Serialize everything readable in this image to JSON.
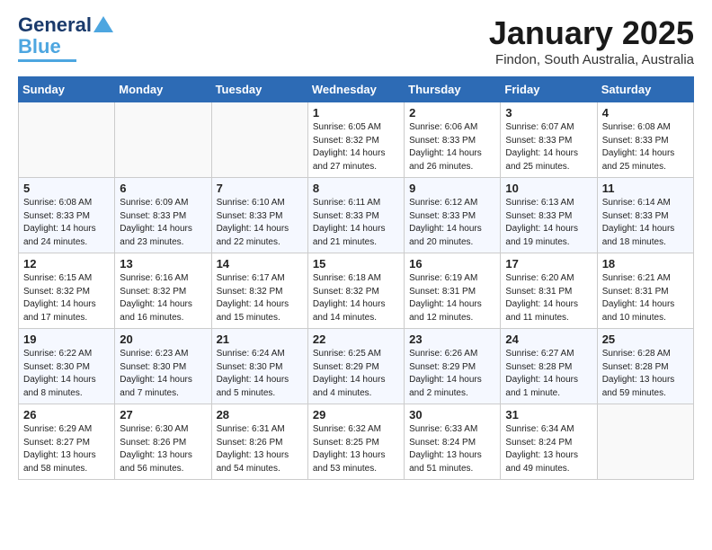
{
  "header": {
    "logo_line1": "General",
    "logo_line2": "Blue",
    "month_title": "January 2025",
    "subtitle": "Findon, South Australia, Australia"
  },
  "days_of_week": [
    "Sunday",
    "Monday",
    "Tuesday",
    "Wednesday",
    "Thursday",
    "Friday",
    "Saturday"
  ],
  "weeks": [
    [
      {
        "day": "",
        "sunrise": "",
        "sunset": "",
        "daylight": ""
      },
      {
        "day": "",
        "sunrise": "",
        "sunset": "",
        "daylight": ""
      },
      {
        "day": "",
        "sunrise": "",
        "sunset": "",
        "daylight": ""
      },
      {
        "day": "1",
        "sunrise": "Sunrise: 6:05 AM",
        "sunset": "Sunset: 8:32 PM",
        "daylight": "Daylight: 14 hours and 27 minutes."
      },
      {
        "day": "2",
        "sunrise": "Sunrise: 6:06 AM",
        "sunset": "Sunset: 8:33 PM",
        "daylight": "Daylight: 14 hours and 26 minutes."
      },
      {
        "day": "3",
        "sunrise": "Sunrise: 6:07 AM",
        "sunset": "Sunset: 8:33 PM",
        "daylight": "Daylight: 14 hours and 25 minutes."
      },
      {
        "day": "4",
        "sunrise": "Sunrise: 6:08 AM",
        "sunset": "Sunset: 8:33 PM",
        "daylight": "Daylight: 14 hours and 25 minutes."
      }
    ],
    [
      {
        "day": "5",
        "sunrise": "Sunrise: 6:08 AM",
        "sunset": "Sunset: 8:33 PM",
        "daylight": "Daylight: 14 hours and 24 minutes."
      },
      {
        "day": "6",
        "sunrise": "Sunrise: 6:09 AM",
        "sunset": "Sunset: 8:33 PM",
        "daylight": "Daylight: 14 hours and 23 minutes."
      },
      {
        "day": "7",
        "sunrise": "Sunrise: 6:10 AM",
        "sunset": "Sunset: 8:33 PM",
        "daylight": "Daylight: 14 hours and 22 minutes."
      },
      {
        "day": "8",
        "sunrise": "Sunrise: 6:11 AM",
        "sunset": "Sunset: 8:33 PM",
        "daylight": "Daylight: 14 hours and 21 minutes."
      },
      {
        "day": "9",
        "sunrise": "Sunrise: 6:12 AM",
        "sunset": "Sunset: 8:33 PM",
        "daylight": "Daylight: 14 hours and 20 minutes."
      },
      {
        "day": "10",
        "sunrise": "Sunrise: 6:13 AM",
        "sunset": "Sunset: 8:33 PM",
        "daylight": "Daylight: 14 hours and 19 minutes."
      },
      {
        "day": "11",
        "sunrise": "Sunrise: 6:14 AM",
        "sunset": "Sunset: 8:33 PM",
        "daylight": "Daylight: 14 hours and 18 minutes."
      }
    ],
    [
      {
        "day": "12",
        "sunrise": "Sunrise: 6:15 AM",
        "sunset": "Sunset: 8:32 PM",
        "daylight": "Daylight: 14 hours and 17 minutes."
      },
      {
        "day": "13",
        "sunrise": "Sunrise: 6:16 AM",
        "sunset": "Sunset: 8:32 PM",
        "daylight": "Daylight: 14 hours and 16 minutes."
      },
      {
        "day": "14",
        "sunrise": "Sunrise: 6:17 AM",
        "sunset": "Sunset: 8:32 PM",
        "daylight": "Daylight: 14 hours and 15 minutes."
      },
      {
        "day": "15",
        "sunrise": "Sunrise: 6:18 AM",
        "sunset": "Sunset: 8:32 PM",
        "daylight": "Daylight: 14 hours and 14 minutes."
      },
      {
        "day": "16",
        "sunrise": "Sunrise: 6:19 AM",
        "sunset": "Sunset: 8:31 PM",
        "daylight": "Daylight: 14 hours and 12 minutes."
      },
      {
        "day": "17",
        "sunrise": "Sunrise: 6:20 AM",
        "sunset": "Sunset: 8:31 PM",
        "daylight": "Daylight: 14 hours and 11 minutes."
      },
      {
        "day": "18",
        "sunrise": "Sunrise: 6:21 AM",
        "sunset": "Sunset: 8:31 PM",
        "daylight": "Daylight: 14 hours and 10 minutes."
      }
    ],
    [
      {
        "day": "19",
        "sunrise": "Sunrise: 6:22 AM",
        "sunset": "Sunset: 8:30 PM",
        "daylight": "Daylight: 14 hours and 8 minutes."
      },
      {
        "day": "20",
        "sunrise": "Sunrise: 6:23 AM",
        "sunset": "Sunset: 8:30 PM",
        "daylight": "Daylight: 14 hours and 7 minutes."
      },
      {
        "day": "21",
        "sunrise": "Sunrise: 6:24 AM",
        "sunset": "Sunset: 8:30 PM",
        "daylight": "Daylight: 14 hours and 5 minutes."
      },
      {
        "day": "22",
        "sunrise": "Sunrise: 6:25 AM",
        "sunset": "Sunset: 8:29 PM",
        "daylight": "Daylight: 14 hours and 4 minutes."
      },
      {
        "day": "23",
        "sunrise": "Sunrise: 6:26 AM",
        "sunset": "Sunset: 8:29 PM",
        "daylight": "Daylight: 14 hours and 2 minutes."
      },
      {
        "day": "24",
        "sunrise": "Sunrise: 6:27 AM",
        "sunset": "Sunset: 8:28 PM",
        "daylight": "Daylight: 14 hours and 1 minute."
      },
      {
        "day": "25",
        "sunrise": "Sunrise: 6:28 AM",
        "sunset": "Sunset: 8:28 PM",
        "daylight": "Daylight: 13 hours and 59 minutes."
      }
    ],
    [
      {
        "day": "26",
        "sunrise": "Sunrise: 6:29 AM",
        "sunset": "Sunset: 8:27 PM",
        "daylight": "Daylight: 13 hours and 58 minutes."
      },
      {
        "day": "27",
        "sunrise": "Sunrise: 6:30 AM",
        "sunset": "Sunset: 8:26 PM",
        "daylight": "Daylight: 13 hours and 56 minutes."
      },
      {
        "day": "28",
        "sunrise": "Sunrise: 6:31 AM",
        "sunset": "Sunset: 8:26 PM",
        "daylight": "Daylight: 13 hours and 54 minutes."
      },
      {
        "day": "29",
        "sunrise": "Sunrise: 6:32 AM",
        "sunset": "Sunset: 8:25 PM",
        "daylight": "Daylight: 13 hours and 53 minutes."
      },
      {
        "day": "30",
        "sunrise": "Sunrise: 6:33 AM",
        "sunset": "Sunset: 8:24 PM",
        "daylight": "Daylight: 13 hours and 51 minutes."
      },
      {
        "day": "31",
        "sunrise": "Sunrise: 6:34 AM",
        "sunset": "Sunset: 8:24 PM",
        "daylight": "Daylight: 13 hours and 49 minutes."
      },
      {
        "day": "",
        "sunrise": "",
        "sunset": "",
        "daylight": ""
      }
    ]
  ]
}
